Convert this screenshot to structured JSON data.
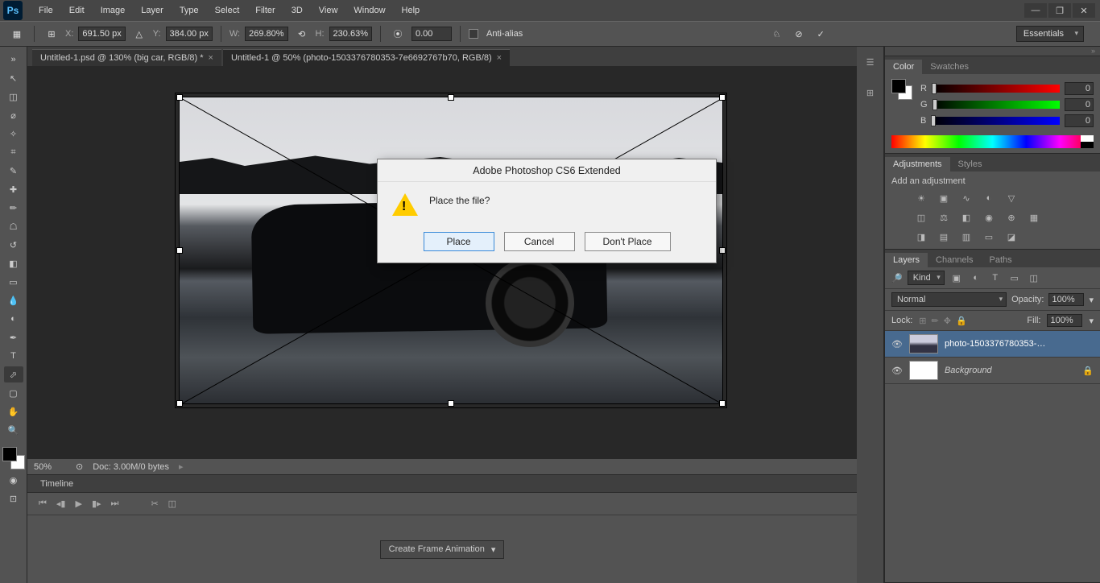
{
  "app": {
    "logo": "Ps"
  },
  "menu": {
    "items": [
      "File",
      "Edit",
      "Image",
      "Layer",
      "Type",
      "Select",
      "Filter",
      "3D",
      "View",
      "Window",
      "Help"
    ]
  },
  "options": {
    "x_label": "X:",
    "x": "691.50 px",
    "y_label": "Y:",
    "y": "384.00 px",
    "w_label": "W:",
    "w": "269.80%",
    "h_label": "H:",
    "h": "230.63%",
    "angle": "0.00",
    "antialias": "Anti-alias",
    "workspace": "Essentials"
  },
  "tabs": [
    {
      "title": "Untitled-1.psd @ 130% (big car, RGB/8) *",
      "active": false
    },
    {
      "title": "Untitled-1 @ 50% (photo-1503376780353-7e6692767b70, RGB/8)",
      "active": true
    }
  ],
  "status": {
    "zoom": "50%",
    "docinfo": "Doc: 3.00M/0 bytes"
  },
  "timeline": {
    "tab": "Timeline",
    "create": "Create Frame Animation"
  },
  "color_panel": {
    "tab_color": "Color",
    "tab_swatches": "Swatches",
    "r_label": "R",
    "r": "0",
    "g_label": "G",
    "g": "0",
    "b_label": "B",
    "b": "0"
  },
  "adjustments": {
    "tab_adj": "Adjustments",
    "tab_styles": "Styles",
    "heading": "Add an adjustment"
  },
  "layers_panel": {
    "tab_layers": "Layers",
    "tab_channels": "Channels",
    "tab_paths": "Paths",
    "kind_label": "Kind",
    "blend": "Normal",
    "opacity_label": "Opacity:",
    "opacity": "100%",
    "lock_label": "Lock:",
    "fill_label": "Fill:",
    "fill": "100%",
    "layers": [
      {
        "name": "photo-1503376780353-…",
        "bg": false
      },
      {
        "name": "Background",
        "bg": true
      }
    ]
  },
  "dialog": {
    "title": "Adobe Photoshop CS6 Extended",
    "message": "Place the file?",
    "btn_place": "Place",
    "btn_cancel": "Cancel",
    "btn_dont": "Don't Place"
  }
}
